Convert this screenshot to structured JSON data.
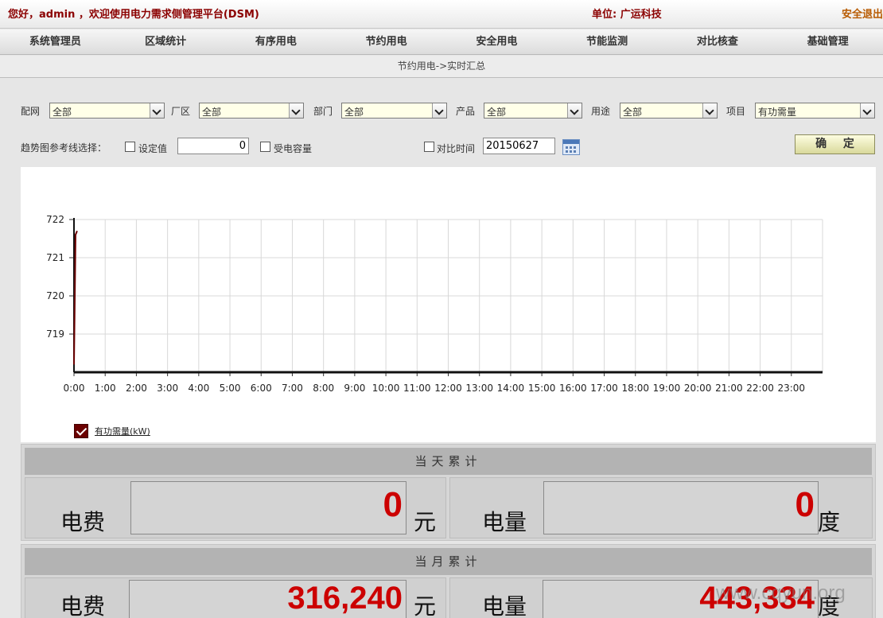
{
  "header": {
    "greeting": "您好，admin ，欢迎使用电力需求侧管理平台(DSM)",
    "unit": "单位: 广运科技",
    "logout": "安全退出"
  },
  "nav": [
    "系统管理员",
    "区域统计",
    "有序用电",
    "节约用电",
    "安全用电",
    "节能监测",
    "对比核查",
    "基础管理"
  ],
  "breadcrumb": "节约用电->实时汇总",
  "filters": {
    "grid_label": "配网",
    "grid_value": "全部",
    "plant_label": "厂区",
    "plant_value": "全部",
    "dept_label": "部门",
    "dept_value": "全部",
    "product_label": "产品",
    "product_value": "全部",
    "usage_label": "用途",
    "usage_value": "全部",
    "item_label": "项目",
    "item_value": "有功需量"
  },
  "reference": {
    "label": "趋势图参考线选择：",
    "setpoint_label": "设定值",
    "setpoint_value": "0",
    "capacity_label": "受电容量",
    "compare_label": "对比时间",
    "compare_value": "20150627",
    "confirm": "确 定"
  },
  "chart_data": {
    "type": "line",
    "x_ticks": [
      "0:00",
      "1:00",
      "2:00",
      "3:00",
      "4:00",
      "5:00",
      "6:00",
      "7:00",
      "8:00",
      "9:00",
      "10:00",
      "11:00",
      "12:00",
      "13:00",
      "14:00",
      "15:00",
      "16:00",
      "17:00",
      "18:00",
      "19:00",
      "20:00",
      "21:00",
      "22:00",
      "23:00"
    ],
    "y_ticks": [
      719,
      720,
      721,
      722
    ],
    "ylim": [
      718,
      722
    ],
    "xlim_hours": [
      0,
      24
    ],
    "grid": true,
    "series": [
      {
        "name": "有功需量(kW)",
        "color": "#6b0000",
        "x_hours": [
          0.0,
          0.05,
          0.1
        ],
        "values": [
          718.2,
          721.6,
          721.7
        ]
      }
    ]
  },
  "today": {
    "title": "当天累计",
    "fee_label": "电费",
    "fee_value": "0",
    "fee_unit": "元",
    "energy_label": "电量",
    "energy_value": "0",
    "energy_unit": "度"
  },
  "month": {
    "title": "当月累计",
    "fee_label": "电费",
    "fee_value": "316,240",
    "fee_unit": "元",
    "energy_label": "电量",
    "energy_value": "443,334",
    "energy_unit": "度"
  },
  "watermark": "www.cqyun.org"
}
